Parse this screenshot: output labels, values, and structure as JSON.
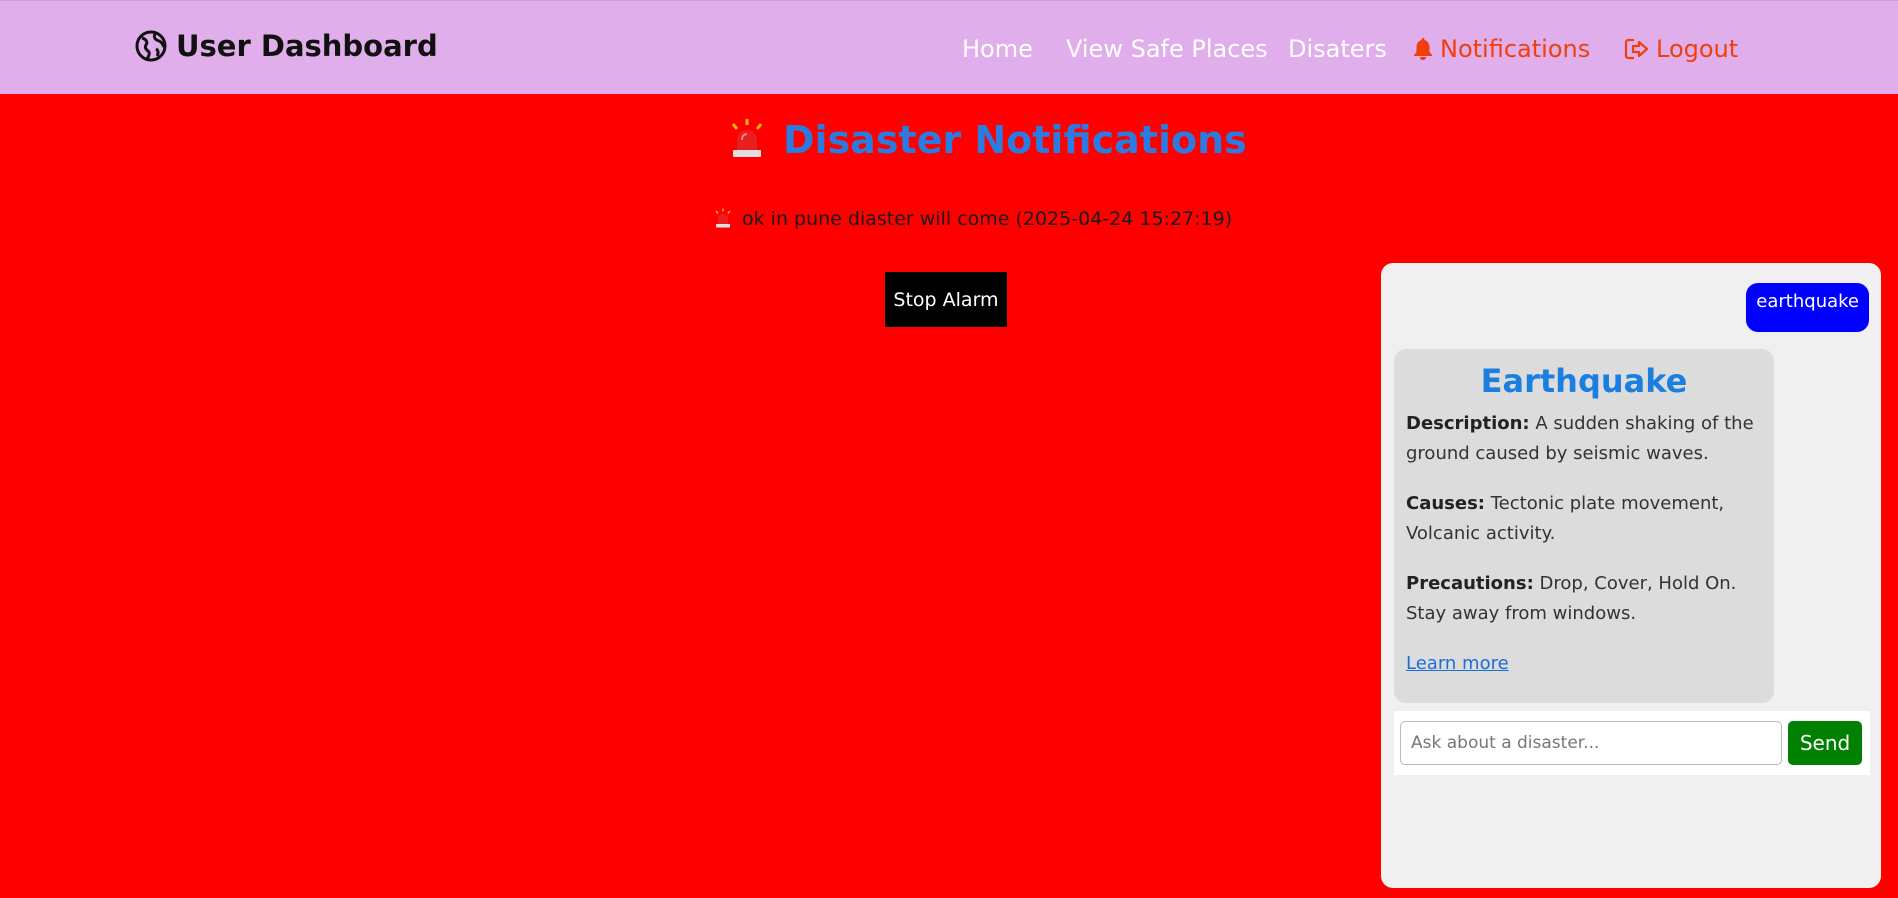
{
  "navbar": {
    "brand": "User Dashboard",
    "brand_icon": "globe-icon",
    "links": {
      "home": "Home",
      "safe_places": "View Safe Places",
      "disasters": "Disaters",
      "notifications": "Notifications",
      "logout": "Logout"
    },
    "accent_color": "#f03f0a",
    "background": "#dfaeeb"
  },
  "main": {
    "title": "Disaster Notifications",
    "title_icon": "siren-icon",
    "notification": "ok in pune diaster will come (2025-04-24 15:27:19)",
    "stop_button": "Stop Alarm",
    "background": "#ff0000"
  },
  "chat": {
    "user_message": "earthquake",
    "card": {
      "title": "Earthquake",
      "description_label": "Description:",
      "description": "A sudden shaking of the ground caused by seismic waves.",
      "causes_label": "Causes:",
      "causes": "Tectonic plate movement, Volcanic activity.",
      "precautions_label": "Precautions:",
      "precautions": "Drop, Cover, Hold On. Stay away from windows.",
      "link": "Learn more"
    },
    "input_placeholder": "Ask about a disaster...",
    "input_value": "",
    "send_button": "Send"
  }
}
